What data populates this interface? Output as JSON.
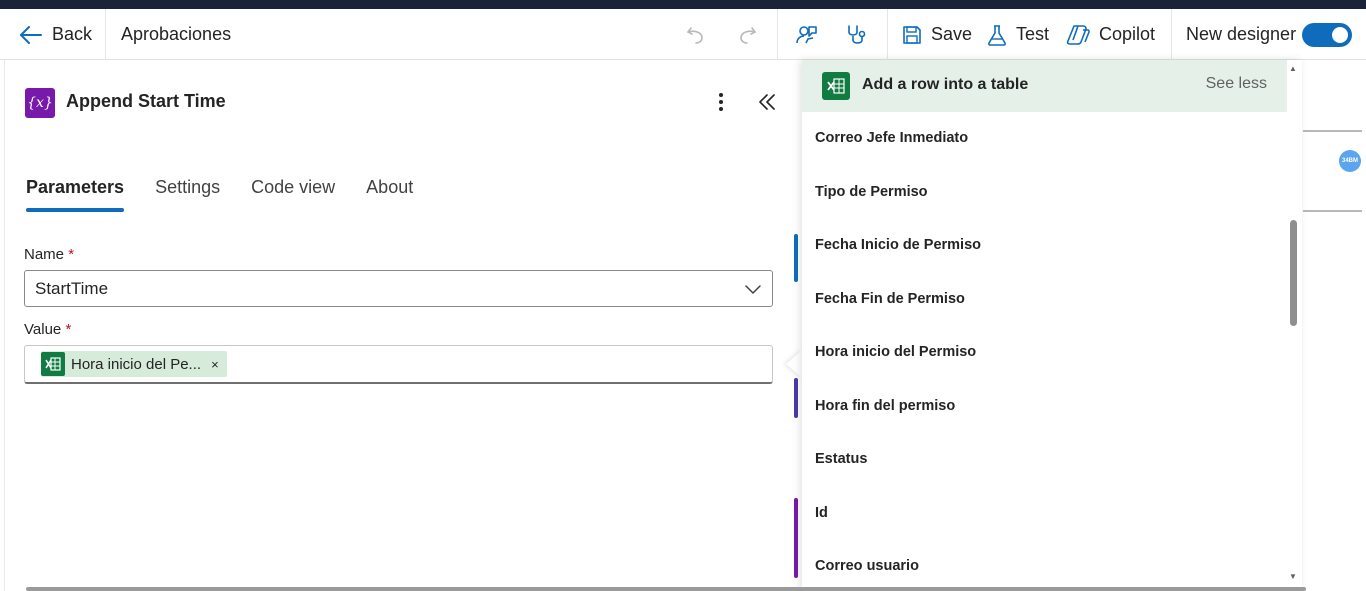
{
  "toolbar": {
    "back_label": "Back",
    "flow_name": "Aprobaciones",
    "save_label": "Save",
    "test_label": "Test",
    "copilot_label": "Copilot",
    "new_designer_label": "New designer",
    "new_designer_on": true
  },
  "action": {
    "icon_text": "{x}",
    "title": "Append Start Time",
    "tabs": [
      {
        "label": "Parameters",
        "active": true
      },
      {
        "label": "Settings",
        "active": false
      },
      {
        "label": "Code view",
        "active": false
      },
      {
        "label": "About",
        "active": false
      }
    ],
    "name_label": "Name",
    "name_value": "StartTime",
    "value_label": "Value",
    "value_token": "Hora inicio del Pe...",
    "token_close": "×",
    "required_mark": "*"
  },
  "dynamic_content": {
    "header_icon_text": "X",
    "header_title": "Add a row into a table",
    "see_less_label": "See less",
    "items": [
      "Correo Jefe Inmediato",
      "Tipo de Permiso",
      "Fecha Inicio de Permiso",
      "Fecha Fin de Permiso",
      "Hora inicio del Permiso",
      "Hora fin del permiso",
      "Estatus",
      "Id",
      "Correo usuario"
    ]
  },
  "canvas": {
    "node_badge": "34BM"
  },
  "colors": {
    "accent": "#0f6cbd",
    "variable_icon": "#7719aa",
    "excel_green": "#107c41",
    "header_bg": "#e5f1e8"
  }
}
